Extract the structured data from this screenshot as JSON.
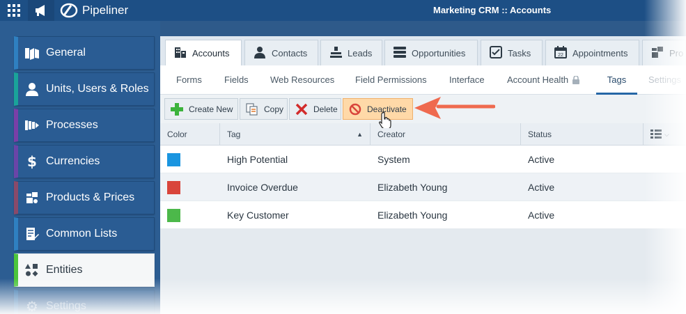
{
  "topbar": {
    "grid_icon": "apps-grid-icon",
    "announcement_icon": "megaphone-icon",
    "brand": "Pipeliner",
    "title": "Marketing CRM :: Accounts"
  },
  "sidebar": {
    "items": [
      {
        "label": "General",
        "icon": "general-icon",
        "accent": "#2f80c1"
      },
      {
        "label": "Units, Users & Roles",
        "icon": "user-icon",
        "accent": "#1aa39a"
      },
      {
        "label": "Processes",
        "icon": "process-icon",
        "accent": "#7a3fa8"
      },
      {
        "label": "Currencies",
        "icon": "dollar-icon",
        "accent": "#6a45a8"
      },
      {
        "label": "Products & Prices",
        "icon": "products-icon",
        "accent": "#8a4a6a"
      },
      {
        "label": "Common Lists",
        "icon": "list-edit-icon",
        "accent": "#2f80c1"
      },
      {
        "label": "Entities",
        "icon": "shapes-icon",
        "accent": "#4cc43c"
      },
      {
        "label": "Settings",
        "icon": "gear-icon",
        "accent": "#2f80c1"
      }
    ]
  },
  "tabs": [
    {
      "label": "Accounts",
      "icon": "building-icon"
    },
    {
      "label": "Contacts",
      "icon": "contact-icon"
    },
    {
      "label": "Leads",
      "icon": "leads-icon"
    },
    {
      "label": "Opportunities",
      "icon": "opportunities-icon"
    },
    {
      "label": "Tasks",
      "icon": "task-check-icon"
    },
    {
      "label": "Appointments",
      "icon": "calendar-icon"
    },
    {
      "label": "Pro",
      "icon": "products-icon"
    }
  ],
  "subtabs": [
    {
      "label": "Forms"
    },
    {
      "label": "Fields"
    },
    {
      "label": "Web Resources"
    },
    {
      "label": "Field Permissions"
    },
    {
      "label": "Interface"
    },
    {
      "label": "Account Health"
    },
    {
      "label": "Tags"
    },
    {
      "label": "Settings"
    }
  ],
  "toolbar": {
    "create_new": "Create New",
    "copy": "Copy",
    "delete": "Delete",
    "deactivate": "Deactivate"
  },
  "table": {
    "columns": [
      "Color",
      "Tag",
      "Creator",
      "Status"
    ],
    "rows": [
      {
        "color": "#1a95e0",
        "tag": "High Potential",
        "creator": "System",
        "status": "Active"
      },
      {
        "color": "#d9453b",
        "tag": "Invoice Overdue",
        "creator": "Elizabeth Young",
        "status": "Active"
      },
      {
        "color": "#4cb84a",
        "tag": "Key Customer",
        "creator": "Elizabeth Young",
        "status": "Active"
      }
    ]
  },
  "colors": {
    "brand_blue": "#1d4f85",
    "highlight": "#ffd9a8",
    "arrow": "#ef6a4f"
  }
}
